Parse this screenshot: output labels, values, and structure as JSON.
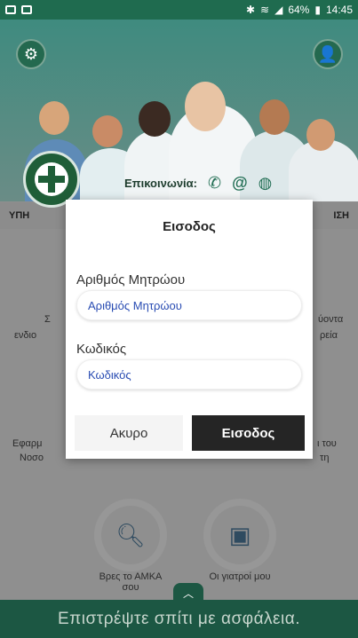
{
  "status": {
    "left_icons": [
      "image-icon",
      "gallery-icon"
    ],
    "battery": "64%",
    "time": "14:45"
  },
  "hero": {
    "contact_label": "Επικοινωνία:"
  },
  "tabs": {
    "left": "ΥΠΗ",
    "right": "ΙΣΗ"
  },
  "grid": {
    "left_partial_1": "Σ",
    "left_partial_2": "ενδιο",
    "right_partial_1": "ύοντα",
    "right_partial_2": "ρεία",
    "left_partial_3": "Εφαρμ",
    "left_partial_4": "Νοσο",
    "right_partial_3": "ι του",
    "right_partial_4": "τη",
    "search_amka": "Βρες το ΑΜΚΑ σου",
    "my_doctors": "Οι γιατροί μου"
  },
  "dialog": {
    "title": "Εισοδος",
    "registry_label": "Αριθμός Μητρώου",
    "registry_placeholder": "Αριθμός Μητρώου",
    "password_label": "Κωδικός",
    "password_placeholder": "Κωδικός",
    "cancel_label": "Ακυρο",
    "login_label": "Εισοδος"
  },
  "banner": {
    "text": "Επιστρέψτε σπίτι με ασφάλεια."
  },
  "colors": {
    "primary": "#1c5743",
    "dark_button": "#252525",
    "link_blue": "#2a4db3"
  }
}
